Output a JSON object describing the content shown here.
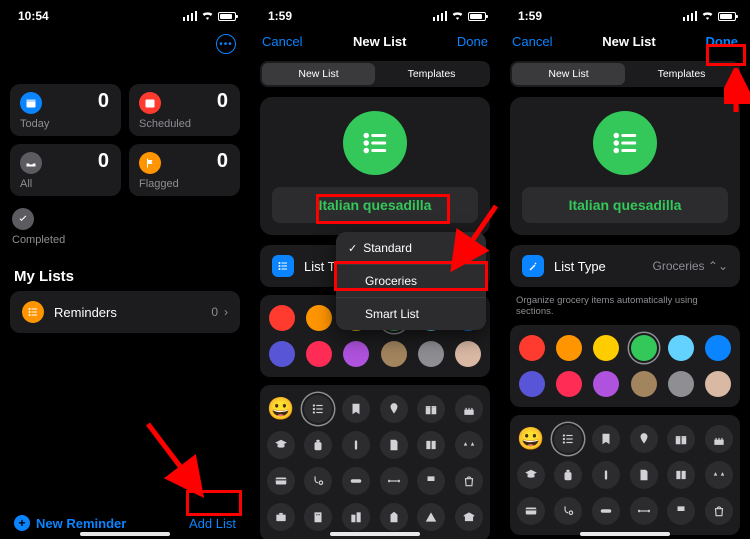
{
  "screen1": {
    "status": {
      "time": "10:54"
    },
    "cards": {
      "today": {
        "label": "Today",
        "count": "0",
        "icon": "calendar-icon",
        "color": "#0a84ff"
      },
      "scheduled": {
        "label": "Scheduled",
        "count": "0",
        "icon": "calendar-icon",
        "color": "#ff3b30"
      },
      "all": {
        "label": "All",
        "count": "0",
        "icon": "tray-icon",
        "color": "#5b5b60"
      },
      "flagged": {
        "label": "Flagged",
        "count": "0",
        "icon": "flag-icon",
        "color": "#ff9500"
      },
      "completed": {
        "label": "Completed",
        "icon": "check-icon",
        "color": "#5b5b60"
      }
    },
    "mylists_header": "My Lists",
    "lists": [
      {
        "name": "Reminders",
        "count": "0",
        "color": "#ff9500"
      }
    ],
    "new_reminder": "New Reminder",
    "add_list": "Add List"
  },
  "screen2": {
    "status": {
      "time": "1:59"
    },
    "nav": {
      "cancel": "Cancel",
      "title": "New List",
      "done": "Done"
    },
    "segmented": {
      "newlist": "New List",
      "templates": "Templates",
      "active": "newlist"
    },
    "icon_color": "#34c759",
    "list_name": "Italian quesadilla",
    "list_type": {
      "label": "List Ty",
      "value": "",
      "icon_color": "#0a84ff"
    },
    "dropdown": {
      "items": [
        {
          "label": "Standard",
          "checked": true
        },
        {
          "label": "Groceries",
          "checked": false
        },
        {
          "label": "Smart List",
          "checked": false
        }
      ]
    },
    "colors": [
      "#ff3b30",
      "#ff9500",
      "#ffcc00",
      "#34c759",
      "#64d2ff",
      "#0a84ff",
      "#5856d6",
      "#ff2d55",
      "#af52de",
      "#a2845e",
      "#8e8e93",
      "#d9b8a4"
    ],
    "icons": [
      "smile",
      "list",
      "bookmark",
      "pin",
      "gift",
      "cake",
      "gradcap",
      "backpack",
      "pause",
      "doc",
      "book",
      "scale",
      "card",
      "stetho",
      "pill",
      "dumbbell",
      "chair",
      "bag",
      "briefcase",
      "bldg",
      "bldg2",
      "church",
      "tent",
      "bank"
    ]
  },
  "screen3": {
    "status": {
      "time": "1:59"
    },
    "nav": {
      "cancel": "Cancel",
      "title": "New List",
      "done": "Done"
    },
    "segmented": {
      "newlist": "New List",
      "templates": "Templates",
      "active": "newlist"
    },
    "icon_color": "#34c759",
    "list_name": "Italian quesadilla",
    "list_type": {
      "label": "List Type",
      "value": "Groceries",
      "icon_color": "#0a84ff"
    },
    "list_type_hint": "Organize grocery items automatically using sections.",
    "colors": [
      "#ff3b30",
      "#ff9500",
      "#ffcc00",
      "#34c759",
      "#64d2ff",
      "#0a84ff",
      "#5856d6",
      "#ff2d55",
      "#af52de",
      "#a2845e",
      "#8e8e93",
      "#d9b8a4"
    ],
    "icons": [
      "smile",
      "list",
      "bookmark",
      "pin",
      "gift",
      "cake",
      "gradcap",
      "backpack",
      "pause",
      "doc",
      "book",
      "scale",
      "card",
      "stetho",
      "pill",
      "dumbbell",
      "chair",
      "bag"
    ]
  }
}
